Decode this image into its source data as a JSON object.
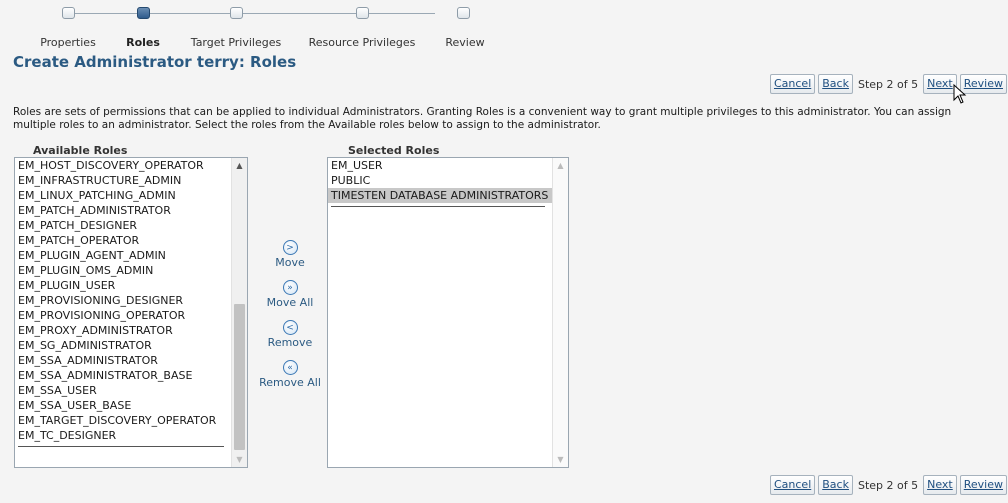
{
  "train": {
    "steps": [
      {
        "label": "Properties",
        "current": false
      },
      {
        "label": "Roles",
        "current": true
      },
      {
        "label": "Target Privileges",
        "current": false
      },
      {
        "label": "Resource Privileges",
        "current": false
      },
      {
        "label": "Review",
        "current": false
      }
    ]
  },
  "page": {
    "title": "Create Administrator terry: Roles"
  },
  "nav": {
    "cancel": "Cancel",
    "back": "Back",
    "step_text": "Step 2 of 5",
    "next": "Next",
    "review": "Review"
  },
  "description": "Roles are sets of permissions that can be applied to individual Administrators. Granting Roles is a convenient way to grant multiple privileges to this administrator. You can assign multiple roles to an administrator. Select the roles from the Available roles below to assign to the administrator.",
  "available": {
    "header": "Available Roles",
    "items": [
      "EM_HOST_DISCOVERY_OPERATOR",
      "EM_INFRASTRUCTURE_ADMIN",
      "EM_LINUX_PATCHING_ADMIN",
      "EM_PATCH_ADMINISTRATOR",
      "EM_PATCH_DESIGNER",
      "EM_PATCH_OPERATOR",
      "EM_PLUGIN_AGENT_ADMIN",
      "EM_PLUGIN_OMS_ADMIN",
      "EM_PLUGIN_USER",
      "EM_PROVISIONING_DESIGNER",
      "EM_PROVISIONING_OPERATOR",
      "EM_PROXY_ADMINISTRATOR",
      "EM_SG_ADMINISTRATOR",
      "EM_SSA_ADMINISTRATOR",
      "EM_SSA_ADMINISTRATOR_BASE",
      "EM_SSA_USER",
      "EM_SSA_USER_BASE",
      "EM_TARGET_DISCOVERY_OPERATOR",
      "EM_TC_DESIGNER"
    ]
  },
  "selected": {
    "header": "Selected Roles",
    "items": [
      "EM_USER",
      "PUBLIC",
      "TIMESTEN DATABASE ADMINISTRATORS"
    ],
    "highlighted_index": 2
  },
  "shuttle": {
    "move": {
      "label": "Move",
      "icon": "chevron-right-icon"
    },
    "move_all": {
      "label": "Move All",
      "icon": "double-chevron-right-icon"
    },
    "remove": {
      "label": "Remove",
      "icon": "chevron-left-icon"
    },
    "remove_all": {
      "label": "Remove All",
      "icon": "double-chevron-left-icon"
    }
  },
  "colors": {
    "title": "#2b5a82",
    "link": "#1f4f80",
    "train_current": "#2f5c8c",
    "selected_row": "#c8c8c8",
    "background": "#f4f4f4"
  }
}
